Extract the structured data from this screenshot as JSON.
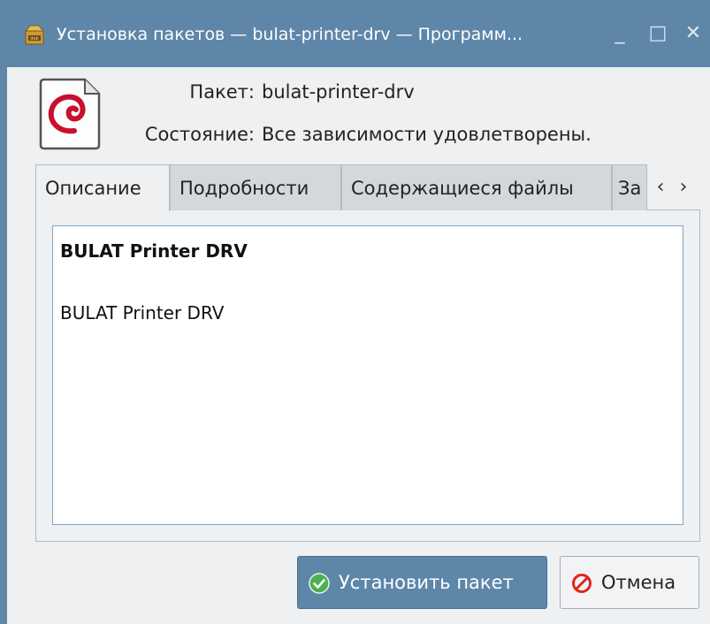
{
  "window": {
    "title": "Установка пакетов — bulat-printer-drv — Программ...",
    "minimize_glyph": "_",
    "maximize_glyph": "□",
    "close_glyph": "✕",
    "title_icon": "deb-package-icon",
    "accent_color": "#5e86a9"
  },
  "header": {
    "package_icon": "debian-swirl-icon",
    "package_label": "Пакет:",
    "package_value": "bulat-printer-drv",
    "state_label": "Состояние:",
    "state_value": "Все зависимости удовлетворены."
  },
  "tabs": [
    {
      "label": "Описание",
      "active": true
    },
    {
      "label": "Подробности",
      "active": false
    },
    {
      "label": "Содержащиеся файлы",
      "active": false
    },
    {
      "label": "За",
      "active": false
    }
  ],
  "tab_scroll": {
    "left": "‹",
    "right": "›"
  },
  "description": {
    "title": "BULAT Printer DRV",
    "body": "BULAT Printer DRV"
  },
  "buttons": {
    "install_label": "Установить пакет",
    "install_icon": "checkmark-circle-icon",
    "cancel_label": "Отмена",
    "cancel_icon": "prohibited-icon"
  }
}
